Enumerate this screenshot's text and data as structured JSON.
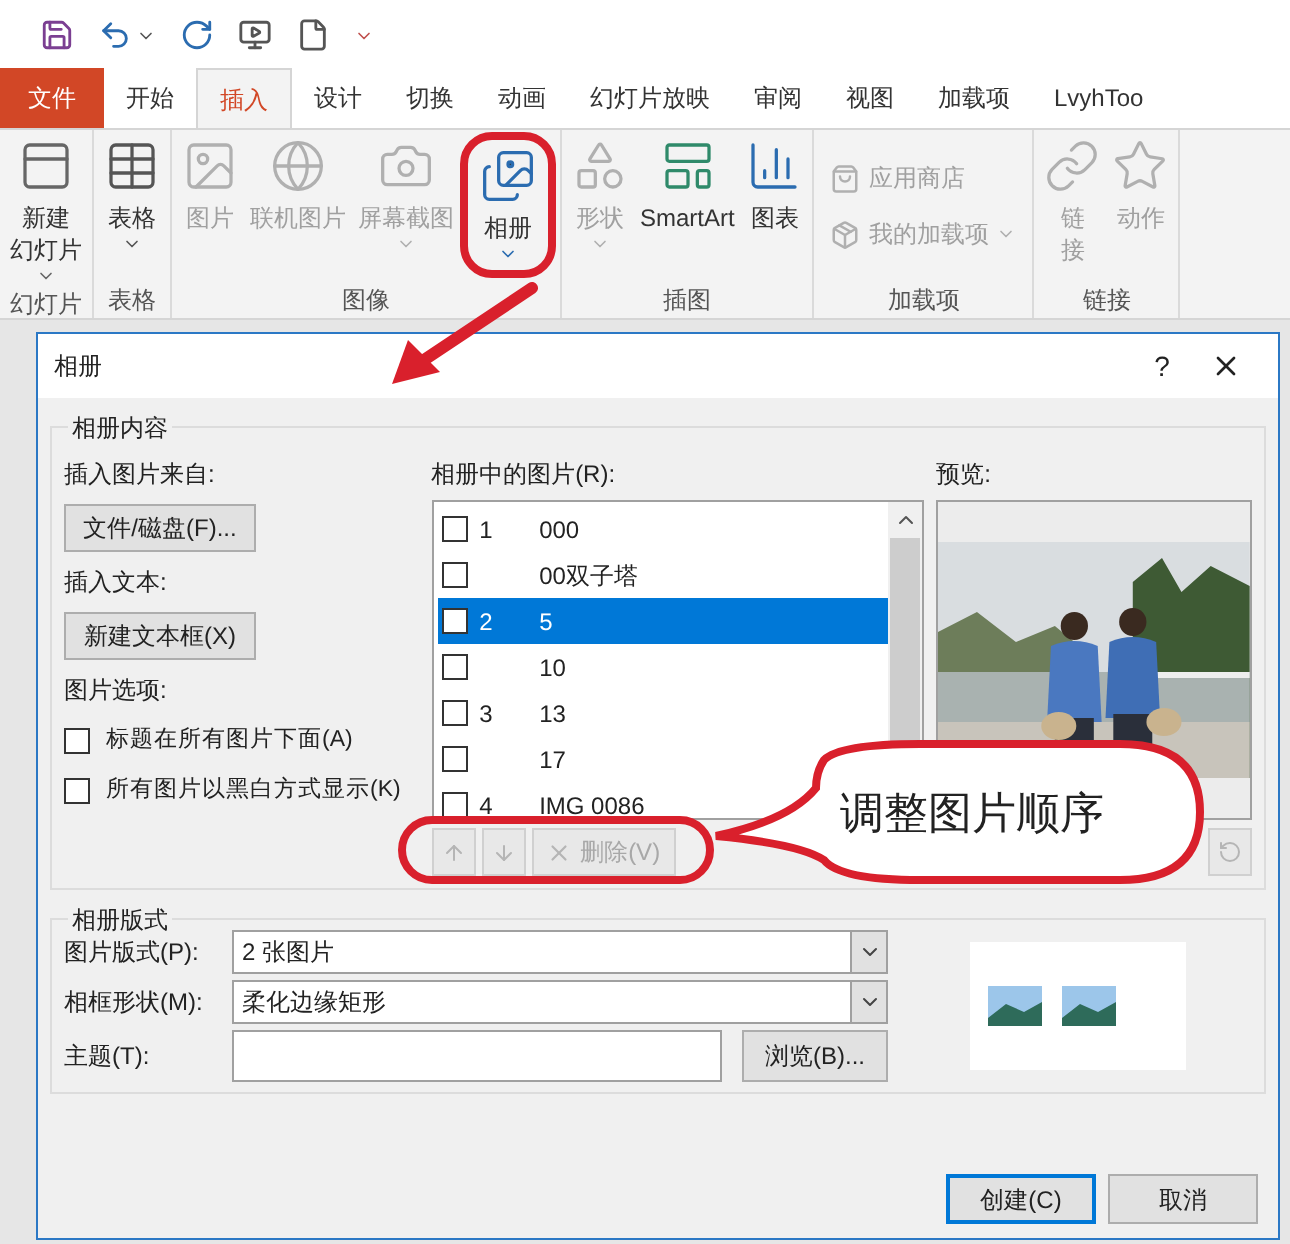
{
  "tabs": [
    {
      "label": "文件",
      "kind": "file",
      "selected": false
    },
    {
      "label": "开始",
      "kind": "tab",
      "selected": false
    },
    {
      "label": "插入",
      "kind": "tab",
      "selected": true
    },
    {
      "label": "设计",
      "kind": "tab",
      "selected": false
    },
    {
      "label": "切换",
      "kind": "tab",
      "selected": false
    },
    {
      "label": "动画",
      "kind": "tab",
      "selected": false
    },
    {
      "label": "幻灯片放映",
      "kind": "tab",
      "selected": false
    },
    {
      "label": "审阅",
      "kind": "tab",
      "selected": false
    },
    {
      "label": "视图",
      "kind": "tab",
      "selected": false
    },
    {
      "label": "加载项",
      "kind": "tab",
      "selected": false
    },
    {
      "label": "LvyhToo",
      "kind": "tab",
      "selected": false
    }
  ],
  "ribbon_groups": [
    {
      "label": "幻灯片",
      "buttons": [
        {
          "kind": "large",
          "lines": [
            "新建",
            "幻灯片"
          ],
          "dropdown": true,
          "disabled": false
        }
      ]
    },
    {
      "label": "表格",
      "buttons": [
        {
          "kind": "large",
          "lines": [
            "表格"
          ],
          "dropdown": true,
          "disabled": false
        }
      ]
    },
    {
      "label": "图像",
      "buttons": [
        {
          "kind": "large",
          "lines": [
            "图片"
          ],
          "dropdown": false,
          "disabled": true
        },
        {
          "kind": "large",
          "lines": [
            "联机图片"
          ],
          "dropdown": false,
          "disabled": true
        },
        {
          "kind": "large",
          "lines": [
            "屏幕截图"
          ],
          "dropdown": true,
          "disabled": true
        },
        {
          "kind": "large",
          "lines": [
            "相册"
          ],
          "dropdown": true,
          "disabled": false,
          "circled": true
        }
      ]
    },
    {
      "label": "插图",
      "buttons": [
        {
          "kind": "large",
          "lines": [
            "形状"
          ],
          "dropdown": true,
          "disabled": true
        },
        {
          "kind": "large",
          "lines": [
            "SmartArt"
          ],
          "dropdown": false,
          "disabled": false
        },
        {
          "kind": "large",
          "lines": [
            "图表"
          ],
          "dropdown": false,
          "disabled": false
        }
      ]
    },
    {
      "label": "加载项",
      "buttons": [
        {
          "kind": "small",
          "lines": [
            "应用商店"
          ],
          "dropdown": false,
          "disabled": true
        },
        {
          "kind": "small",
          "lines": [
            "我的加载项"
          ],
          "dropdown": true,
          "disabled": true
        }
      ]
    },
    {
      "label": "链接",
      "buttons": [
        {
          "kind": "large",
          "lines": [
            "链",
            "接"
          ],
          "dropdown": false,
          "disabled": true
        },
        {
          "kind": "large",
          "lines": [
            "动作"
          ],
          "dropdown": false,
          "disabled": true
        }
      ]
    }
  ],
  "dialog": {
    "title": "相册",
    "help": "?",
    "content": {
      "title": "相册内容",
      "source_label": "插入图片来自:",
      "file_button": "文件/磁盘(F)...",
      "text_label": "插入文本:",
      "textbox_button": "新建文本框(X)",
      "options_label": "图片选项:",
      "options": [
        {
          "label": "标题在所有图片下面(A)",
          "checked": false
        },
        {
          "label": "所有图片以黑白方式显示(K)",
          "checked": false
        }
      ],
      "list_label": "相册中的图片(R):",
      "pictures": [
        {
          "slide": "1",
          "name": "000",
          "checked": false,
          "selected": false
        },
        {
          "name": "00双子塔",
          "checked": false,
          "selected": false
        },
        {
          "slide": "2",
          "name": "5",
          "checked": false,
          "selected": true
        },
        {
          "name": "10",
          "checked": false,
          "selected": false
        },
        {
          "slide": "3",
          "name": "13",
          "checked": false,
          "selected": false
        },
        {
          "name": "17",
          "checked": false,
          "selected": false
        },
        {
          "slide": "4",
          "name": "IMG 0086",
          "checked": false,
          "selected": false
        }
      ],
      "list_buttons": [
        {
          "kind": "up",
          "disabled": true
        },
        {
          "kind": "down",
          "disabled": true
        },
        {
          "kind": "remove",
          "label": "删除(V)",
          "disabled": true
        }
      ],
      "preview_label": "预览:"
    },
    "layout": {
      "title": "相册版式",
      "fields": [
        {
          "kind": "select",
          "label": "图片版式(P):",
          "value": "2 张图片"
        },
        {
          "kind": "select",
          "label": "相框形状(M):",
          "value": "柔化边缘矩形"
        },
        {
          "kind": "text",
          "label": "主题(T):",
          "button": "浏览(B)..."
        }
      ]
    },
    "buttons": [
      {
        "label": "创建(C)",
        "default": true
      },
      {
        "label": "取消",
        "default": false
      }
    ]
  },
  "annotation": {
    "callout": "调整图片顺序"
  }
}
